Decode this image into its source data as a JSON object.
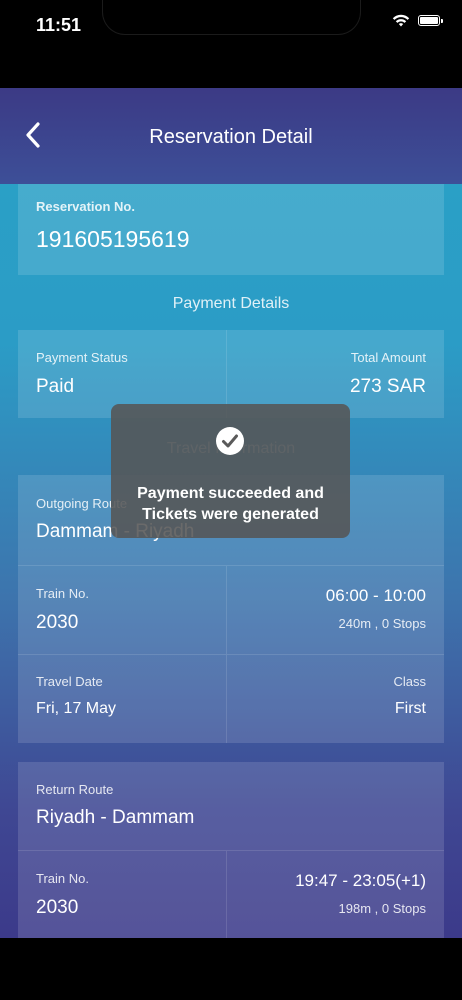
{
  "status_bar": {
    "time": "11:51"
  },
  "header": {
    "title": "Reservation Detail"
  },
  "reservation": {
    "label": "Reservation No.",
    "number": "191605195619"
  },
  "payment": {
    "section_title": "Payment Details",
    "status_label": "Payment Status",
    "status_value": "Paid",
    "amount_label": "Total Amount",
    "amount_value": "273 SAR"
  },
  "travel": {
    "section_title": "Travel Information",
    "outgoing": {
      "route_label": "Outgoing Route",
      "route_value": "Dammam - Riyadh",
      "train_label": "Train No.",
      "train_value": "2030",
      "time_value": "06:00 - 10:00",
      "duration_value": "240m , 0 Stops",
      "date_label": "Travel Date",
      "date_value": "Fri, 17 May",
      "class_label": "Class",
      "class_value": "First"
    },
    "return": {
      "route_label": "Return Route",
      "route_value": "Riyadh - Dammam",
      "train_label": "Train No.",
      "train_value": "2030",
      "time_value": "19:47 - 23:05(+1)",
      "duration_value": "198m , 0 Stops"
    }
  },
  "toast": {
    "line1": "Payment succeeded and",
    "line2": "Tickets were generated"
  },
  "icons": {
    "back": "chevron-left-icon",
    "check": "check-circle-icon",
    "wifi": "wifi-icon",
    "battery": "battery-icon"
  }
}
